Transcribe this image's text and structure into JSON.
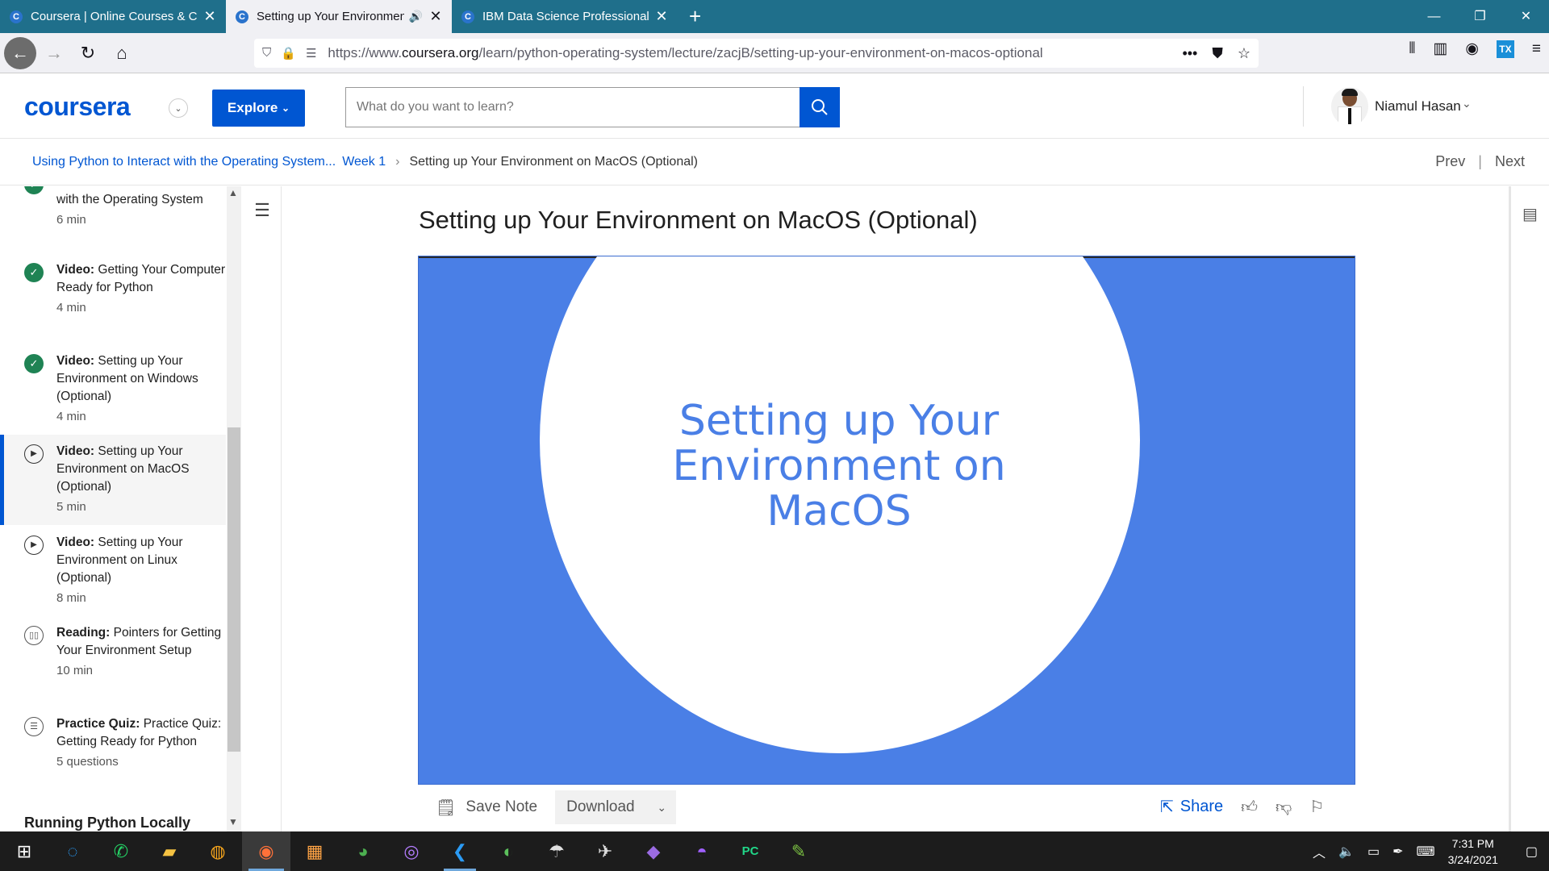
{
  "browser": {
    "tabs": [
      {
        "label": "Coursera | Online Courses & Cr",
        "favicon": "C"
      },
      {
        "label": "Setting up Your Environmen",
        "favicon": "C"
      },
      {
        "label": "IBM Data Science Professional",
        "favicon": "C"
      }
    ],
    "url_prefix": "https://www.",
    "url_domain": "coursera.org",
    "url_path": "/learn/python-operating-system/lecture/zacjB/setting-up-your-environment-on-macos-optional"
  },
  "header": {
    "logo": "coursera",
    "explore_label": "Explore",
    "search_placeholder": "What do you want to learn?",
    "user_name": "Niamul Hasan"
  },
  "breadcrumb": {
    "course": "Using Python to Interact with the Operating System...",
    "week": "Week 1",
    "current": "Setting up Your Environment on MacOS (Optional)",
    "prev": "Prev",
    "next": "Next"
  },
  "sidebar": {
    "items": [
      {
        "type_label": "",
        "title": "with the Operating System",
        "duration": "6 min",
        "status": "done"
      },
      {
        "type_label": "Video:",
        "title": "Getting Your Computer Ready for Python",
        "duration": "4 min",
        "status": "done"
      },
      {
        "type_label": "Video:",
        "title": "Setting up Your Environment on Windows (Optional)",
        "duration": "4 min",
        "status": "done"
      },
      {
        "type_label": "Video:",
        "title": "Setting up Your Environment on MacOS (Optional)",
        "duration": "5 min",
        "status": "play"
      },
      {
        "type_label": "Video:",
        "title": "Setting up Your Environment on Linux (Optional)",
        "duration": "8 min",
        "status": "play"
      },
      {
        "type_label": "Reading:",
        "title": "Pointers for Getting Your Environment Setup",
        "duration": "10 min",
        "status": "read"
      },
      {
        "type_label": "Practice Quiz:",
        "title": "Practice Quiz: Getting Ready for Python",
        "duration": "5 questions",
        "status": "quiz"
      }
    ],
    "section_heading": "Running Python Locally"
  },
  "main": {
    "title": "Setting up Your Environment on MacOS (Optional)",
    "slide_text": "Setting up Your Environment on MacOS",
    "save_note": "Save Note",
    "download": "Download",
    "share": "Share"
  },
  "taskbar": {
    "time": "7:31 PM",
    "date": "3/24/2021"
  },
  "colors": {
    "brand": "#0056d2",
    "slide_blue": "#4a7fe6",
    "done_green": "#1f8354",
    "tab_bar": "#1f6f8b"
  }
}
